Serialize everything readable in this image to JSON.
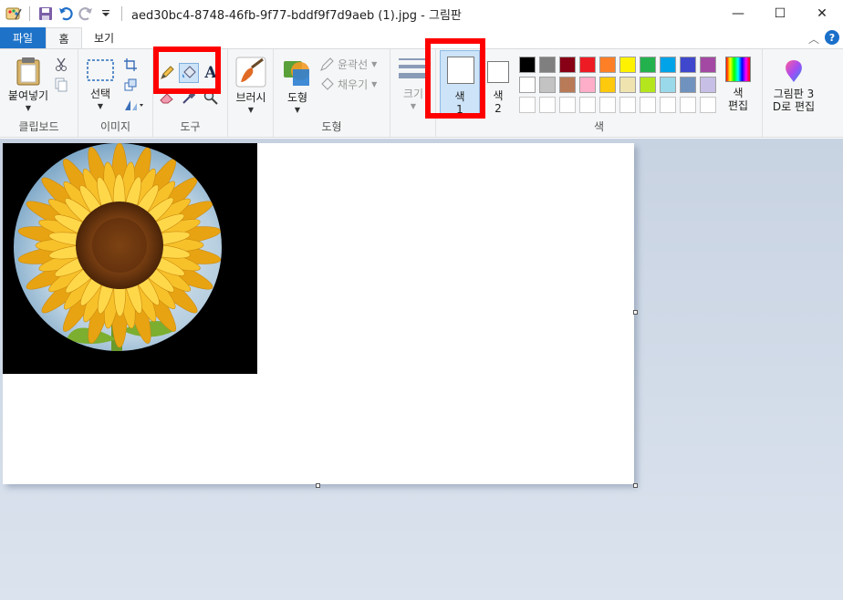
{
  "window": {
    "title": "aed30bc4-8748-46fb-9f77-bddf9f7d9aeb (1).jpg - 그림판",
    "minimize": "—",
    "maximize": "☐",
    "close": "✕"
  },
  "tabs": {
    "file": "파일",
    "home": "홈",
    "view": "보기"
  },
  "ribbon": {
    "clipboard": {
      "paste": "붙여넣기",
      "group": "클립보드"
    },
    "image": {
      "select": "선택",
      "group": "이미지"
    },
    "tools": {
      "group": "도구"
    },
    "brushes": {
      "label": "브러시"
    },
    "shapes": {
      "shapes": "도형",
      "outline": "윤곽선",
      "fill": "채우기",
      "group": "도형"
    },
    "size": {
      "label": "크기"
    },
    "colors": {
      "color1_a": "색",
      "color1_b": "1",
      "color2_a": "색",
      "color2_b": "2",
      "edit_a": "색",
      "edit_b": "편집",
      "group": "색",
      "row1": [
        "#000000",
        "#7f7f7f",
        "#880015",
        "#ed1c24",
        "#ff7f27",
        "#fff200",
        "#22b14c",
        "#00a2e8",
        "#3f48cc",
        "#a349a4"
      ],
      "row2": [
        "#ffffff",
        "#c3c3c3",
        "#b97a57",
        "#ffaec9",
        "#ffc90e",
        "#efe4b0",
        "#b5e61d",
        "#99d9ea",
        "#7092be",
        "#c8bfe7"
      ]
    },
    "paint3d": {
      "line1": "그림판 3",
      "line2": "D로 편집"
    }
  }
}
